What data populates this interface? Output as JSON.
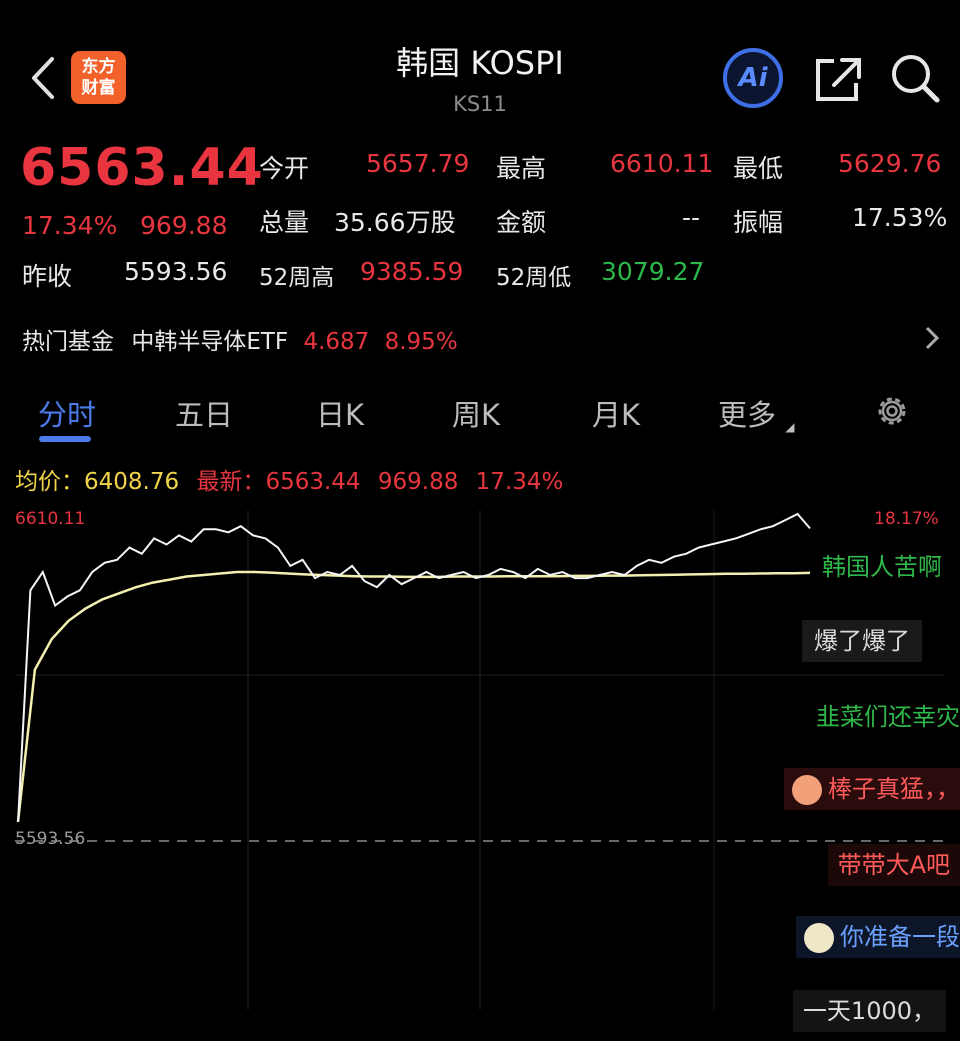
{
  "header": {
    "title": "韩国 KOSPI",
    "code": "KS11",
    "logo_line1": "东方",
    "logo_line2": "财富",
    "ai_label": "Ai"
  },
  "quote": {
    "price": "6563.44",
    "change_pct": "17.34%",
    "change": "969.88",
    "prev_close_label": "昨收",
    "prev_close": "5593.56",
    "open_label": "今开",
    "open": "5657.79",
    "high_label": "最高",
    "high": "6610.11",
    "low_label": "最低",
    "low": "5629.76",
    "volume_label": "总量",
    "volume": "35.66万股",
    "amount_label": "金额",
    "amount": "--",
    "amplitude_label": "振幅",
    "amplitude": "17.53%",
    "high52_label": "52周高",
    "high52": "9385.59",
    "low52_label": "52周低",
    "low52": "3079.27"
  },
  "fund": {
    "label": "热门基金",
    "name": "中韩半导体ETF",
    "price": "4.687",
    "change_pct": "8.95%"
  },
  "tabs": [
    {
      "label": "分时",
      "active": true
    },
    {
      "label": "五日"
    },
    {
      "label": "日K"
    },
    {
      "label": "周K"
    },
    {
      "label": "月K"
    },
    {
      "label": "更多"
    }
  ],
  "legend": {
    "avg_label": "均价：",
    "avg_value": "6408.76",
    "latest_label": "最新：",
    "latest_value": "6563.44",
    "latest_change": "969.88",
    "latest_pct": "17.34%"
  },
  "chart_data": {
    "type": "line",
    "y_max_label": "6610.11",
    "y_base_label": "5593.56",
    "y_max_pct_label": "18.17%",
    "ylim": [
      5593.56,
      6610.11
    ],
    "series": [
      {
        "values": [
          5600,
          6360,
          6420,
          6310,
          6340,
          6360,
          6420,
          6450,
          6460,
          6500,
          6480,
          6530,
          6510,
          6540,
          6520,
          6560,
          6560,
          6550,
          6570,
          6540,
          6530,
          6500,
          6440,
          6460,
          6400,
          6420,
          6410,
          6440,
          6390,
          6370,
          6410,
          6380,
          6400,
          6420,
          6400,
          6410,
          6420,
          6400,
          6410,
          6430,
          6420,
          6400,
          6430,
          6410,
          6420,
          6400,
          6400,
          6410,
          6420,
          6410,
          6440,
          6460,
          6450,
          6470,
          6480,
          6500,
          6510,
          6520,
          6530,
          6545,
          6560,
          6570,
          6590,
          6610,
          6563
        ]
      },
      {
        "values": [
          5600,
          6100,
          6200,
          6260,
          6300,
          6330,
          6350,
          6370,
          6385,
          6395,
          6405,
          6410,
          6415,
          6420,
          6420,
          6418,
          6415,
          6412,
          6410,
          6408,
          6406,
          6405,
          6405,
          6404,
          6404,
          6404,
          6405,
          6405,
          6405,
          6406,
          6406,
          6406,
          6406,
          6407,
          6407,
          6408,
          6408,
          6409,
          6410,
          6411,
          6412,
          6413,
          6414,
          6414,
          6415,
          6416,
          6416,
          6417
        ]
      }
    ]
  },
  "danmaku": [
    {
      "text": "韩国人苦啊",
      "color": "#2fb84a"
    },
    {
      "text": "爆了爆了",
      "color": "#dcdcdc"
    },
    {
      "text": "韭菜们还幸灾",
      "color": "#2fb84a"
    },
    {
      "text": "棒子真猛，，",
      "color": "#ff5a5a"
    },
    {
      "text": "带带大A吧",
      "color": "#ff5a5a"
    },
    {
      "text": "你准备一段",
      "color": "#6aa0ff"
    },
    {
      "text": "一天1000，",
      "color": "#dcdcdc"
    }
  ]
}
